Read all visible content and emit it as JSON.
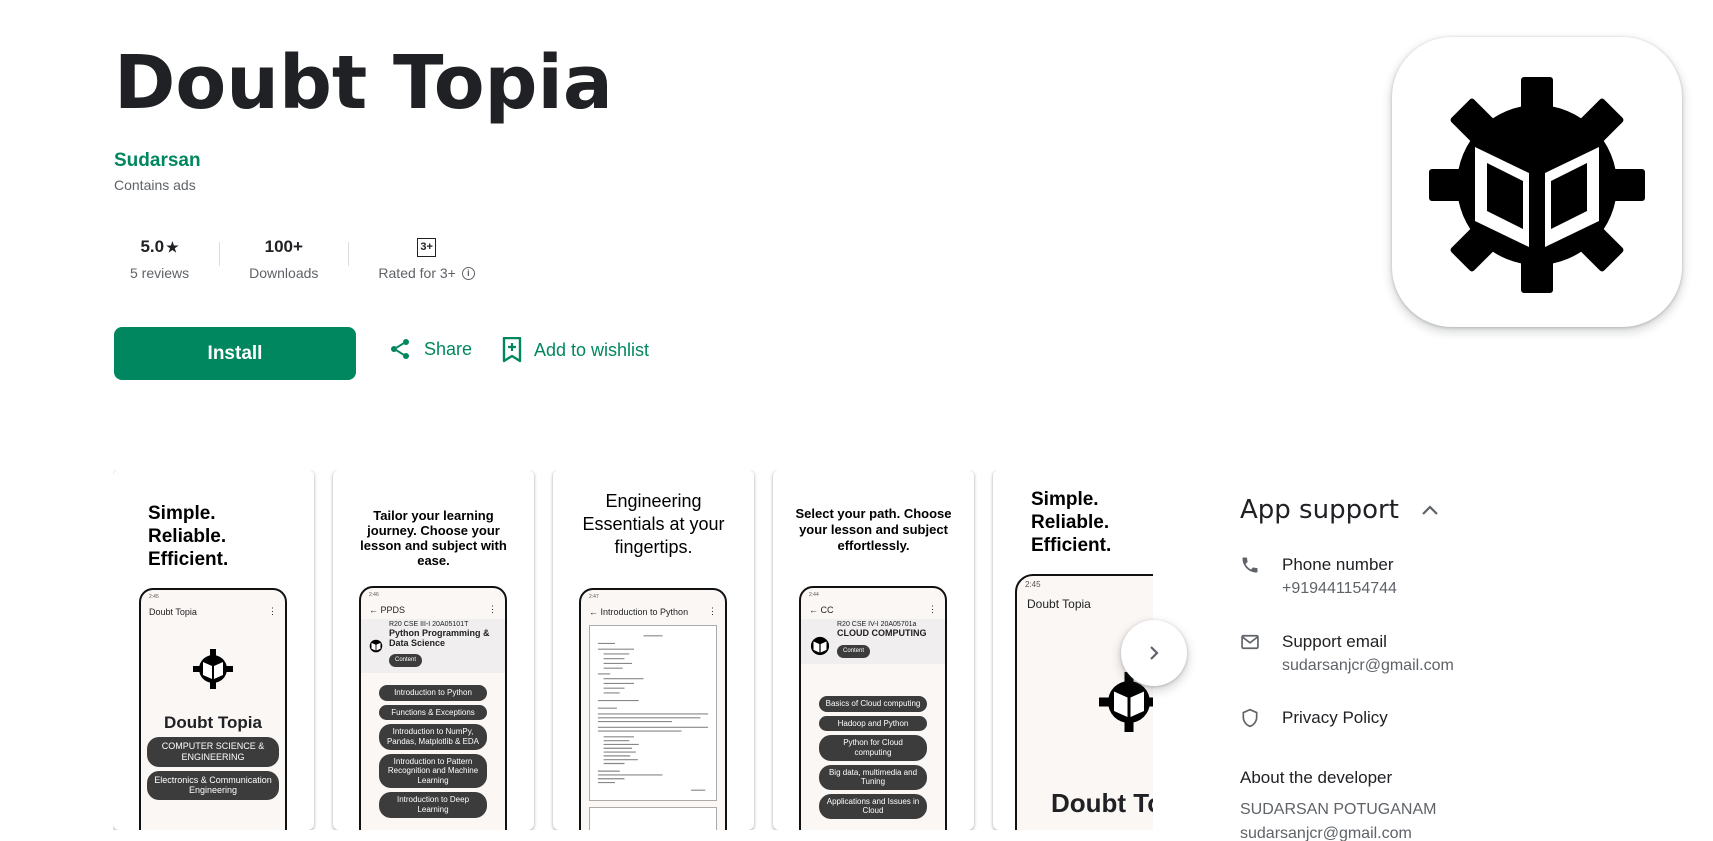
{
  "app": {
    "title": "Doubt Topia",
    "developer": "Sudarsan",
    "ads_notice": "Contains ads"
  },
  "stats": {
    "rating": "5.0",
    "reviews": "5 reviews",
    "downloads": "100+",
    "downloads_label": "Downloads",
    "content_rating_badge": "3+",
    "content_rating_label": "Rated for 3+"
  },
  "actions": {
    "install": "Install",
    "share": "Share",
    "wishlist": "Add to wishlist"
  },
  "colors": {
    "accent": "#01875f",
    "text": "#202124",
    "secondary": "#5f6368"
  },
  "screenshots": [
    {
      "heading_lines": [
        "Simple.",
        "Reliable.",
        "Efficient."
      ],
      "phone_bar_title": "Doubt Topia",
      "phone_app_title": "Doubt Topia",
      "buttons": [
        "COMPUTER SCIENCE & ENGINEERING",
        "Electronics & Communication Engineering"
      ]
    },
    {
      "heading": "Tailor your learning journey. Choose your lesson and subject with ease.",
      "phone_bar_title": "PPDS",
      "course_code": "R20 CSE III-I 20A05101T",
      "course_name": "Python Programming & Data Science",
      "content_btn": "Content",
      "buttons": [
        "Introduction to Python",
        "Functions & Exceptions",
        "Introduction to NumPy, Pandas, Matplotlib & EDA",
        "Introduction to Pattern Recognition and Machine Learning",
        "Introduction to Deep Learning"
      ]
    },
    {
      "heading": "Engineering Essentials at your fingertips.",
      "phone_bar_title": "Introduction to Python"
    },
    {
      "heading": "Select your path. Choose your lesson and subject effortlessly.",
      "phone_bar_title": "CC",
      "course_code": "R20 CSE IV-I 20A05701a",
      "course_name": "CLOUD COMPUTING",
      "content_btn": "Content",
      "buttons": [
        "Basics of Cloud computing",
        "Hadoop and Python",
        "Python for Cloud computing",
        "Big data, multimedia and Tuning",
        "Applications and Issues in Cloud"
      ]
    },
    {
      "heading_lines": [
        "Simple.",
        "Reliable.",
        "Efficient."
      ],
      "phone_bar_title": "Doubt Topia",
      "phone_app_title": "Doubt Topia"
    }
  ],
  "support": {
    "title": "App support",
    "phone_label": "Phone number",
    "phone_value": "+919441154744",
    "email_label": "Support email",
    "email_value": "sudarsanjcr@gmail.com",
    "privacy_label": "Privacy Policy",
    "about_title": "About the developer",
    "about_name": "SUDARSAN POTUGANAM",
    "about_email": "sudarsanjcr@gmail.com"
  }
}
